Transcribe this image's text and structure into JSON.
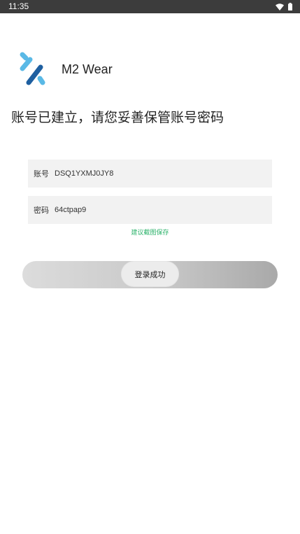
{
  "status_bar": {
    "time": "11:35",
    "icons": [
      "wifi-icon",
      "battery-icon"
    ]
  },
  "app": {
    "name": "M2 Wear",
    "logo_icon": "m2-wear-logo-icon",
    "logo_colors": {
      "light": "#5ab9e6",
      "dark": "#1e5fa0"
    }
  },
  "heading": "账号已建立，请您妥善保管账号密码",
  "account": {
    "label": "账号",
    "value": "DSQ1YXMJ0JY8"
  },
  "password": {
    "label": "密码",
    "value": "64ctpap9"
  },
  "hint": "建议截图保存",
  "slider": {
    "label": "登录成功"
  },
  "colors": {
    "status_bar": "#3c3c3c",
    "hint": "#2db36b",
    "field_bg": "#f2f2f2"
  }
}
